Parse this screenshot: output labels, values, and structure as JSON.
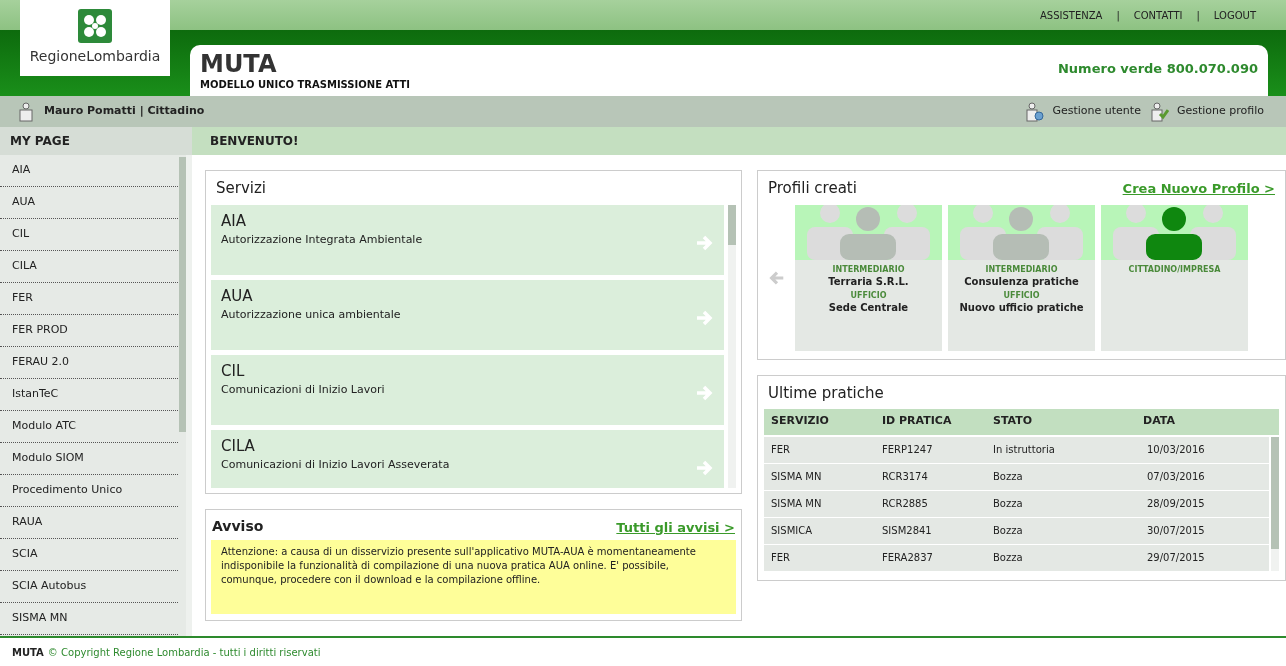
{
  "logo": {
    "text": "RegioneLombardia"
  },
  "top_links": [
    "ASSISTENZA",
    "CONTATTI",
    "LOGOUT"
  ],
  "top_separator": "|",
  "app": {
    "title": "MUTA",
    "subtitle": "MODELLO UNICO TRASMISSIONE ATTI",
    "phone": "Numero verde 800.070.090"
  },
  "user_bar": {
    "user": "Mauro Pomatti | Cittadino",
    "actions": [
      {
        "kind": "user",
        "label": "Gestione utente"
      },
      {
        "kind": "profile",
        "label": "Gestione profilo"
      }
    ]
  },
  "sidebar": {
    "title": "MY PAGE",
    "items": [
      "AIA",
      "AUA",
      "CIL",
      "CILA",
      "FER",
      "FER PROD",
      "FERAU 2.0",
      "IstanTeC",
      "Modulo ATC",
      "Modulo SIOM",
      "Procedimento Unico",
      "RAUA",
      "SCIA",
      "SCIA Autobus",
      "SISMA MN"
    ]
  },
  "page_title": "BENVENUTO!",
  "servizi": {
    "title": "Servizi",
    "items": [
      {
        "code": "AIA",
        "description": "Autorizzazione Integrata Ambientale"
      },
      {
        "code": "AUA",
        "description": "Autorizzazione unica ambientale"
      },
      {
        "code": "CIL",
        "description": "Comunicazioni di Inizio Lavori"
      },
      {
        "code": "CILA",
        "description": "Comunicazioni di Inizio Lavori Asseverata"
      }
    ]
  },
  "avviso": {
    "title": "Avviso",
    "link": "Tutti gli avvisi >",
    "message": "Attenzione: a causa di un disservizio presente sull'applicativo MUTA-AUA è momentaneamente indisponibile la funzionalità di compilazione di una nuova pratica AUA online. E' possibile, comunque, procedere con il download e la compilazione offline."
  },
  "profili": {
    "title": "Profili creati",
    "link": "Crea Nuovo Profilo >",
    "cards": [
      {
        "selected": false,
        "lines": [
          {
            "kind": "label",
            "text": "INTERMEDIARIO"
          },
          {
            "kind": "value",
            "text": "Terraria S.R.L."
          },
          {
            "kind": "label",
            "text": "UFFICIO"
          },
          {
            "kind": "value",
            "text": "Sede Centrale"
          }
        ]
      },
      {
        "selected": false,
        "lines": [
          {
            "kind": "label",
            "text": "INTERMEDIARIO"
          },
          {
            "kind": "value",
            "text": "Consulenza pratiche"
          },
          {
            "kind": "label",
            "text": "UFFICIO"
          },
          {
            "kind": "value",
            "text": "Nuovo ufficio pratiche"
          }
        ]
      },
      {
        "selected": true,
        "lines": [
          {
            "kind": "label",
            "text": "CITTADINO/IMPRESA"
          }
        ]
      }
    ]
  },
  "pratiche": {
    "title": "Ultime pratiche",
    "columns": [
      "SERVIZIO",
      "ID PRATICA",
      "STATO",
      "DATA"
    ],
    "rows": [
      [
        "FER",
        "FERP1247",
        "In istruttoria",
        "10/03/2016"
      ],
      [
        "SISMA MN",
        "RCR3174",
        "Bozza",
        "07/03/2016"
      ],
      [
        "SISMA MN",
        "RCR2885",
        "Bozza",
        "28/09/2015"
      ],
      [
        "SISMICA",
        "SISM2841",
        "Bozza",
        "30/07/2015"
      ],
      [
        "FER",
        "FERA2837",
        "Bozza",
        "29/07/2015"
      ]
    ]
  },
  "footer": {
    "brand": "MUTA",
    "copyright": "© Copyright Regione Lombardia - tutti i diritti riservati"
  }
}
